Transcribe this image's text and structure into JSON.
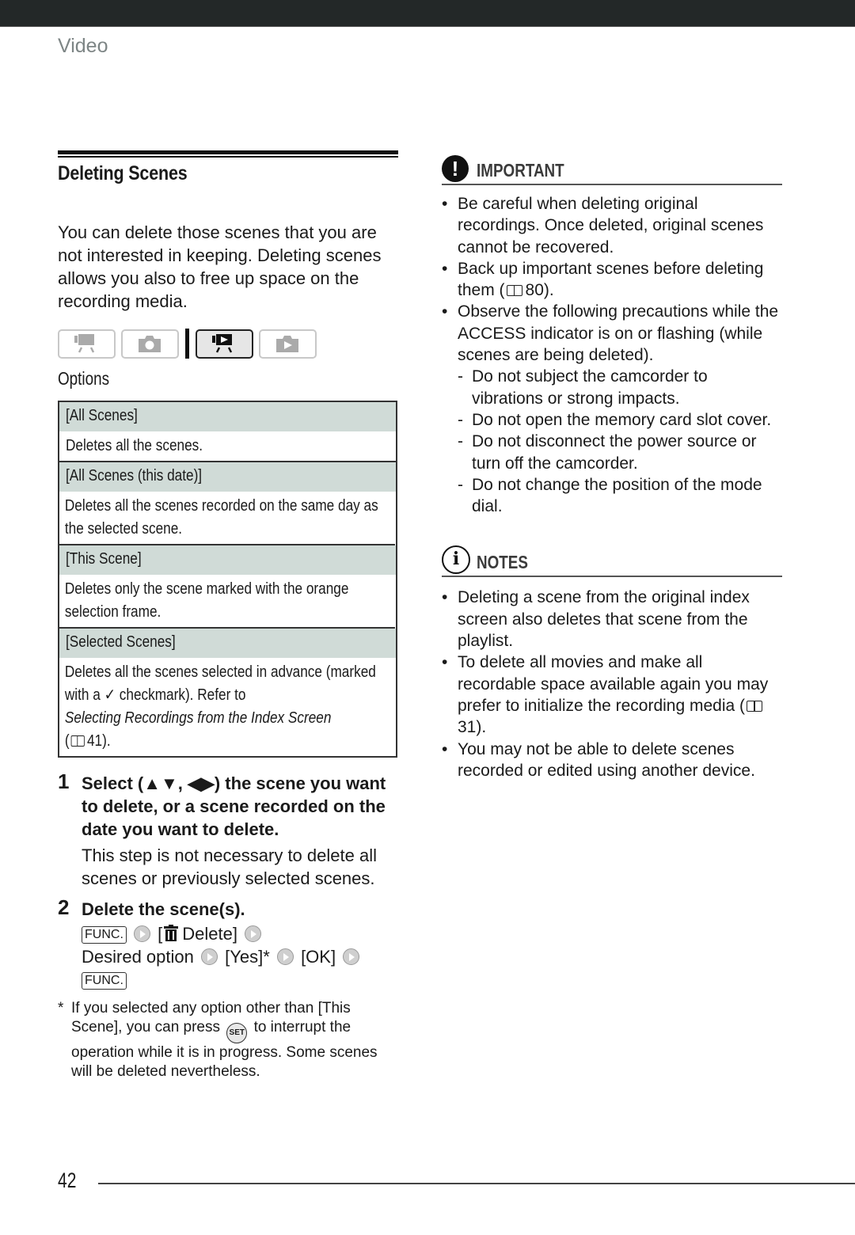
{
  "header": {
    "section": "Video"
  },
  "main": {
    "title": "Deleting Scenes",
    "intro": "You can delete those scenes that you are not interested in keeping. Deleting scenes allows you also to free up space on the recording media.",
    "mode_icons": [
      {
        "name": "movie-record-mode",
        "active": false
      },
      {
        "name": "photo-record-mode",
        "active": false
      },
      {
        "name": "movie-playback-mode",
        "active": true
      },
      {
        "name": "photo-playback-mode",
        "active": false
      }
    ],
    "options_title": "Options",
    "options": [
      {
        "name": "[All Scenes]",
        "description": "Deletes all the scenes."
      },
      {
        "name": "[All Scenes (this date)]",
        "description": "Deletes all the scenes recorded on the same day as the selected scene."
      },
      {
        "name": "[This Scene]",
        "description": "Deletes only the scene marked with the orange selection frame."
      },
      {
        "name": "[Selected Scenes]",
        "description_part1": "Deletes all the scenes selected in advance (marked with a",
        "checkmark": "✓",
        "description_part2": "checkmark). Refer to",
        "description_link": "Selecting Recordings from the Index Screen",
        "page_ref": "41)."
      }
    ],
    "steps": [
      {
        "number": "1",
        "heading_prefix": "Select (▲▼, ◀▶) the scene you want to delete, or a scene recorded on the date you want to delete.",
        "body": "This step is not necessary to delete all scenes or previously selected scenes."
      },
      {
        "number": "2",
        "heading": "Delete the scene(s).",
        "sequence": {
          "func": "FUNC.",
          "delete_item": "Delete]",
          "open_bracket": "[",
          "desired": "Desired option",
          "yes": "[Yes]*",
          "ok": "[OK]",
          "func_end": "FUNC."
        }
      }
    ],
    "footnote": {
      "star": "*",
      "part1": "If you selected any option other than [This Scene], you can press",
      "set_button": "SET",
      "part2": "to interrupt the operation while it is in progress. Some scenes will be deleted nevertheless."
    }
  },
  "important": {
    "title": "IMPORTANT",
    "icon": "!",
    "items": [
      "Be careful when deleting original recordings. Once deleted, original scenes cannot be recovered.",
      {
        "text": "Back up important scenes before deleting them (",
        "page": "80)."
      },
      "Observe the following precautions while the ACCESS indicator is on or flashing (while scenes are being deleted)."
    ],
    "sub_items": [
      "Do not subject the camcorder to vibrations or strong impacts.",
      "Do not open the memory card slot cover.",
      "Do not disconnect the power source or turn off the camcorder.",
      "Do not change the position of the mode dial."
    ]
  },
  "notes": {
    "title": "NOTES",
    "icon": "i",
    "items": [
      "Deleting a scene from the original index screen also deletes that scene from the playlist.",
      {
        "text": "To delete all movies and make all recordable space available again you may prefer to initialize the recording media (",
        "page": "31)."
      },
      "You may not be able to delete scenes recorded or edited using another device."
    ]
  },
  "footer": {
    "page_number": "42"
  }
}
